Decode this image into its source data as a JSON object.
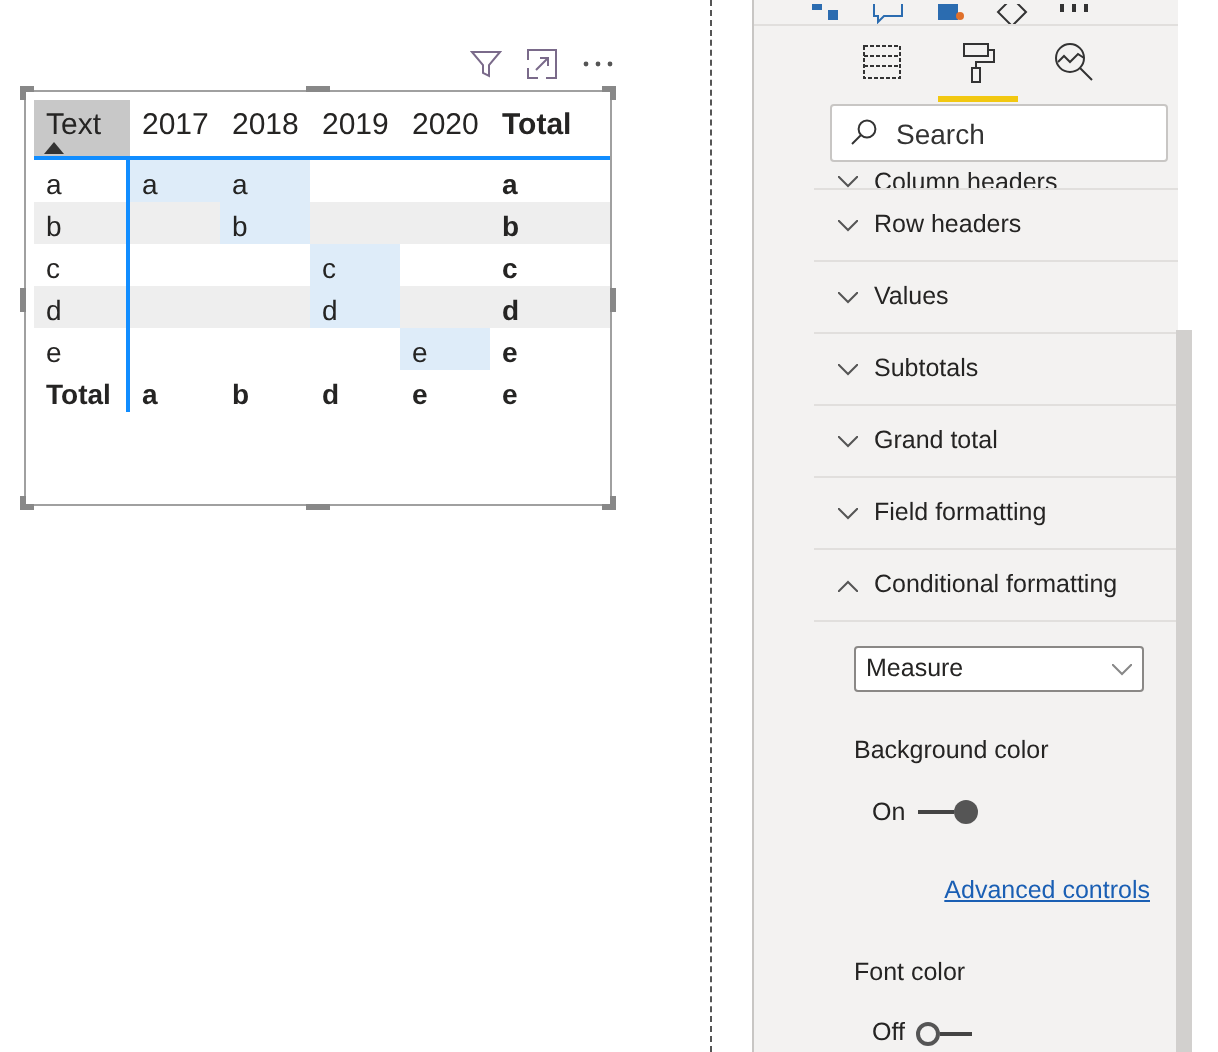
{
  "table": {
    "columns": [
      "Text",
      "2017",
      "2018",
      "2019",
      "2020",
      "Total"
    ],
    "rows": [
      {
        "shaded": false,
        "cells": [
          {
            "text": "a",
            "highlighted": false
          },
          {
            "text": "a",
            "highlighted": true
          },
          {
            "text": "a",
            "highlighted": true
          },
          {
            "text": "",
            "highlighted": false
          },
          {
            "text": "",
            "highlighted": false
          },
          {
            "text": "a",
            "highlighted": false
          }
        ]
      },
      {
        "shaded": true,
        "cells": [
          {
            "text": "b",
            "highlighted": false
          },
          {
            "text": "",
            "highlighted": false
          },
          {
            "text": "b",
            "highlighted": true
          },
          {
            "text": "",
            "highlighted": false
          },
          {
            "text": "",
            "highlighted": false
          },
          {
            "text": "b",
            "highlighted": false
          }
        ]
      },
      {
        "shaded": false,
        "cells": [
          {
            "text": "c",
            "highlighted": false
          },
          {
            "text": "",
            "highlighted": false
          },
          {
            "text": "",
            "highlighted": false
          },
          {
            "text": "c",
            "highlighted": true
          },
          {
            "text": "",
            "highlighted": false
          },
          {
            "text": "c",
            "highlighted": false
          }
        ]
      },
      {
        "shaded": true,
        "cells": [
          {
            "text": "d",
            "highlighted": false
          },
          {
            "text": "",
            "highlighted": false
          },
          {
            "text": "",
            "highlighted": false
          },
          {
            "text": "d",
            "highlighted": true
          },
          {
            "text": "",
            "highlighted": false
          },
          {
            "text": "d",
            "highlighted": false
          }
        ]
      },
      {
        "shaded": false,
        "cells": [
          {
            "text": "e",
            "highlighted": false
          },
          {
            "text": "",
            "highlighted": false
          },
          {
            "text": "",
            "highlighted": false
          },
          {
            "text": "",
            "highlighted": false
          },
          {
            "text": "e",
            "highlighted": true
          },
          {
            "text": "e",
            "highlighted": false
          }
        ]
      }
    ],
    "totals_row": [
      "Total",
      "a",
      "b",
      "d",
      "e",
      "e"
    ]
  },
  "pane": {
    "tabs": [
      {
        "kind": "fields",
        "selected": false
      },
      {
        "kind": "format",
        "selected": true
      },
      {
        "kind": "analytics",
        "selected": false
      }
    ],
    "search": {
      "placeholder": "Search"
    },
    "sections": [
      {
        "label": "Column headers",
        "expanded": false
      },
      {
        "label": "Row headers",
        "expanded": false
      },
      {
        "label": "Values",
        "expanded": false
      },
      {
        "label": "Subtotals",
        "expanded": false
      },
      {
        "label": "Grand total",
        "expanded": false
      },
      {
        "label": "Field formatting",
        "expanded": false
      },
      {
        "label": "Conditional formatting",
        "expanded": true
      }
    ],
    "conditional": {
      "dropdown": "Measure",
      "background_color": {
        "label": "Background color",
        "toggle": "On",
        "on": true
      },
      "link": "Advanced controls",
      "font_color": {
        "label": "Font color",
        "toggle": "Off",
        "on": false
      }
    }
  }
}
